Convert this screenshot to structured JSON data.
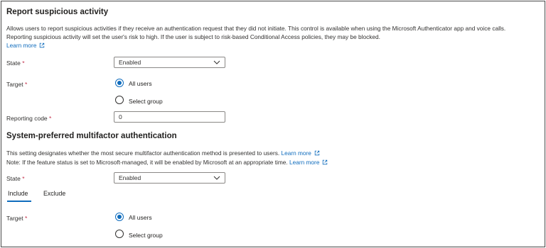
{
  "report_section": {
    "title": "Report suspicious activity",
    "description_line1": "Allows users to report suspicious activities if they receive an authentication request that they did not initiate. This control is available when using the Microsoft Authenticator app and voice calls.",
    "description_line2": "Reporting suspicious activity will set the user's risk to high. If the user is subject to risk-based Conditional Access policies, they may be blocked.",
    "learn_more": "Learn more",
    "state_label": "State",
    "state_value": "Enabled",
    "target_label": "Target",
    "target_options": [
      "All users",
      "Select group"
    ],
    "target_selected": "All users",
    "reporting_code_label": "Reporting code",
    "reporting_code_value": "0"
  },
  "system_section": {
    "title": "System-preferred multifactor authentication",
    "description_line1": "This setting designates whether the most secure multifactor authentication method is presented to users.",
    "learn_more_1": "Learn more",
    "description_line2": "Note: If the feature status is set to Microsoft-managed, it will be enabled by Microsoft at an appropriate time.",
    "learn_more_2": "Learn more",
    "state_label": "State",
    "state_value": "Enabled",
    "tabs": [
      "Include",
      "Exclude"
    ],
    "active_tab": "Include",
    "target_label": "Target",
    "target_options": [
      "All users",
      "Select group"
    ],
    "target_selected": "All users"
  },
  "required_marker": "*",
  "icons": {
    "external_link": "external-link-icon",
    "chevron": "chevron-down-icon"
  },
  "colors": {
    "accent": "#0f6cbd",
    "required": "#c4314b",
    "text": "#323130",
    "border": "#8a8886"
  }
}
